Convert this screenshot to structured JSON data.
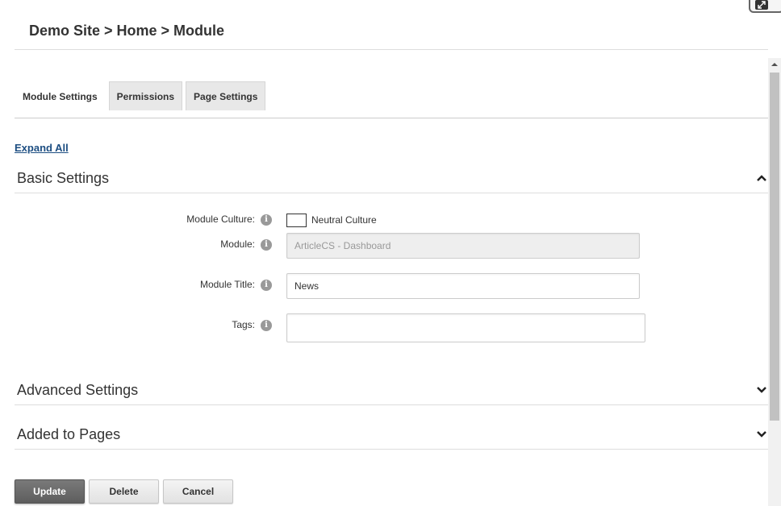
{
  "breadcrumb": "Demo Site > Home > Module",
  "tabs": [
    {
      "label": "Module Settings",
      "active": true
    },
    {
      "label": "Permissions",
      "active": false
    },
    {
      "label": "Page Settings",
      "active": false
    }
  ],
  "expand_all": "Expand All",
  "sections": {
    "basic": {
      "title": "Basic Settings",
      "expanded": true
    },
    "advanced": {
      "title": "Advanced Settings",
      "expanded": false
    },
    "added_to_pages": {
      "title": "Added to Pages",
      "expanded": false
    }
  },
  "fields": {
    "module_culture": {
      "label": "Module Culture:",
      "checkbox_label": "Neutral Culture"
    },
    "module": {
      "label": "Module:",
      "value": "ArticleCS - Dashboard"
    },
    "module_title": {
      "label": "Module Title:",
      "value": "News"
    },
    "tags": {
      "label": "Tags:",
      "value": ""
    }
  },
  "info_glyph": "i",
  "buttons": {
    "update": "Update",
    "delete": "Delete",
    "cancel": "Cancel"
  },
  "colors": {
    "link": "#1d4e82",
    "primary_button": "#6a6a6a",
    "tab_inactive": "#e8e8e8"
  }
}
